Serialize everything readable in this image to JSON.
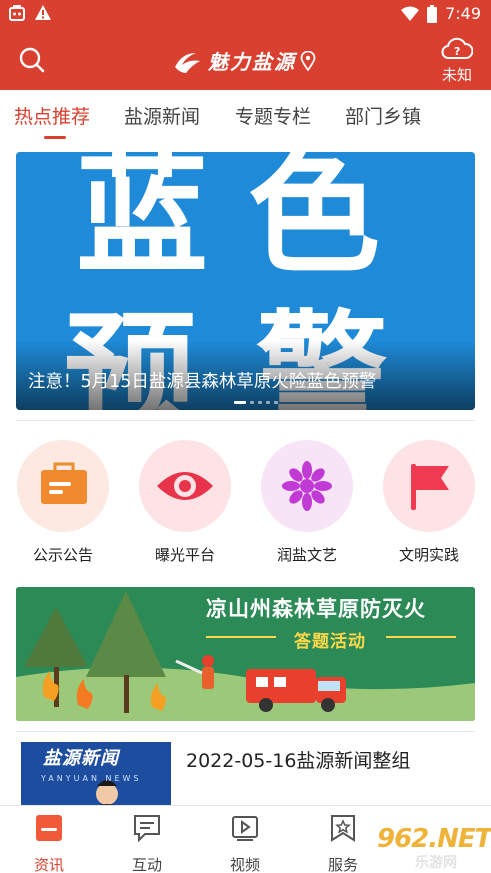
{
  "status_bar": {
    "time": "7:49"
  },
  "header": {
    "title": "魅力盐源",
    "weather_label": "未知"
  },
  "tabs": [
    {
      "label": "热点推荐"
    },
    {
      "label": "盐源新闻"
    },
    {
      "label": "专题专栏"
    },
    {
      "label": "部门乡镇"
    }
  ],
  "banner": {
    "art_text_line1": "蓝色",
    "art_text_line2": "预警",
    "caption": "注意！5月15日盐源县森林草原火险蓝色预警",
    "slide_count": 5,
    "active_slide": 1
  },
  "quick_entries": [
    {
      "label": "公示公告",
      "icon": "bulletin-icon",
      "bg": "#fde8e2",
      "color": "#f08a2e"
    },
    {
      "label": "曝光平台",
      "icon": "eye-icon",
      "bg": "#fde3e6",
      "color": "#e8344a"
    },
    {
      "label": "润盐文艺",
      "icon": "flower-icon",
      "bg": "#f7e4f6",
      "color": "#c23ad6"
    },
    {
      "label": "文明实践",
      "icon": "flag-icon",
      "bg": "#fde3e6",
      "color": "#ef3b52"
    }
  ],
  "promo": {
    "title": "凉山州森林草原防灭火",
    "subtitle": "答题活动"
  },
  "news": {
    "thumb_title": "盐源新闻",
    "thumb_subtitle": "YANYUAN NEWS",
    "title": "2022-05-16盐源新闻整组"
  },
  "bottom_nav": [
    {
      "label": "资讯",
      "icon": "news-icon"
    },
    {
      "label": "互动",
      "icon": "chat-icon"
    },
    {
      "label": "视频",
      "icon": "video-icon"
    },
    {
      "label": "服务",
      "icon": "service-icon"
    }
  ],
  "watermark": {
    "text": "962.NET",
    "sub": "乐游网"
  },
  "colors": {
    "brand": "#d9402f",
    "accent": "#d9402f"
  }
}
